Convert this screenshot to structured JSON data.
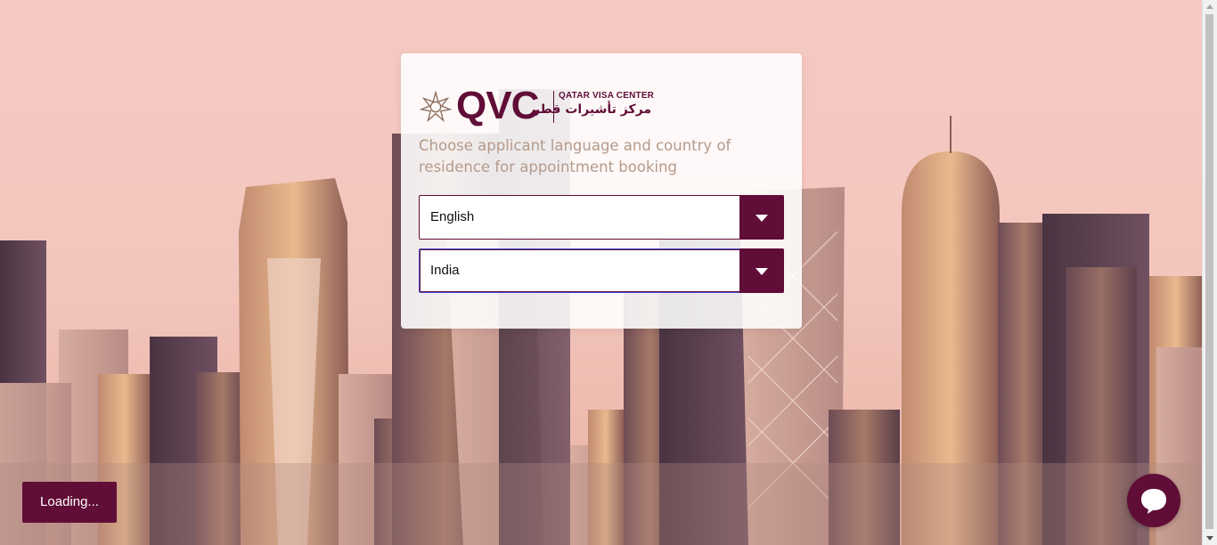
{
  "brand": {
    "name": "QVC",
    "english_name": "QATAR VISA CENTER",
    "arabic_name": "مركز تأشيرات قطر"
  },
  "form": {
    "instruction": "Choose applicant language and country of residence for appointment booking",
    "language_select": {
      "value": "English"
    },
    "country_select": {
      "value": "India"
    }
  },
  "status": {
    "loading_text": "Loading..."
  },
  "icons": {
    "logo": "qvc-star-logo-icon",
    "dropdown": "caret-down-icon",
    "chat": "chat-bubble-icon"
  },
  "colors": {
    "brand_maroon": "#600d37",
    "subtitle_text": "#b59a8a"
  }
}
